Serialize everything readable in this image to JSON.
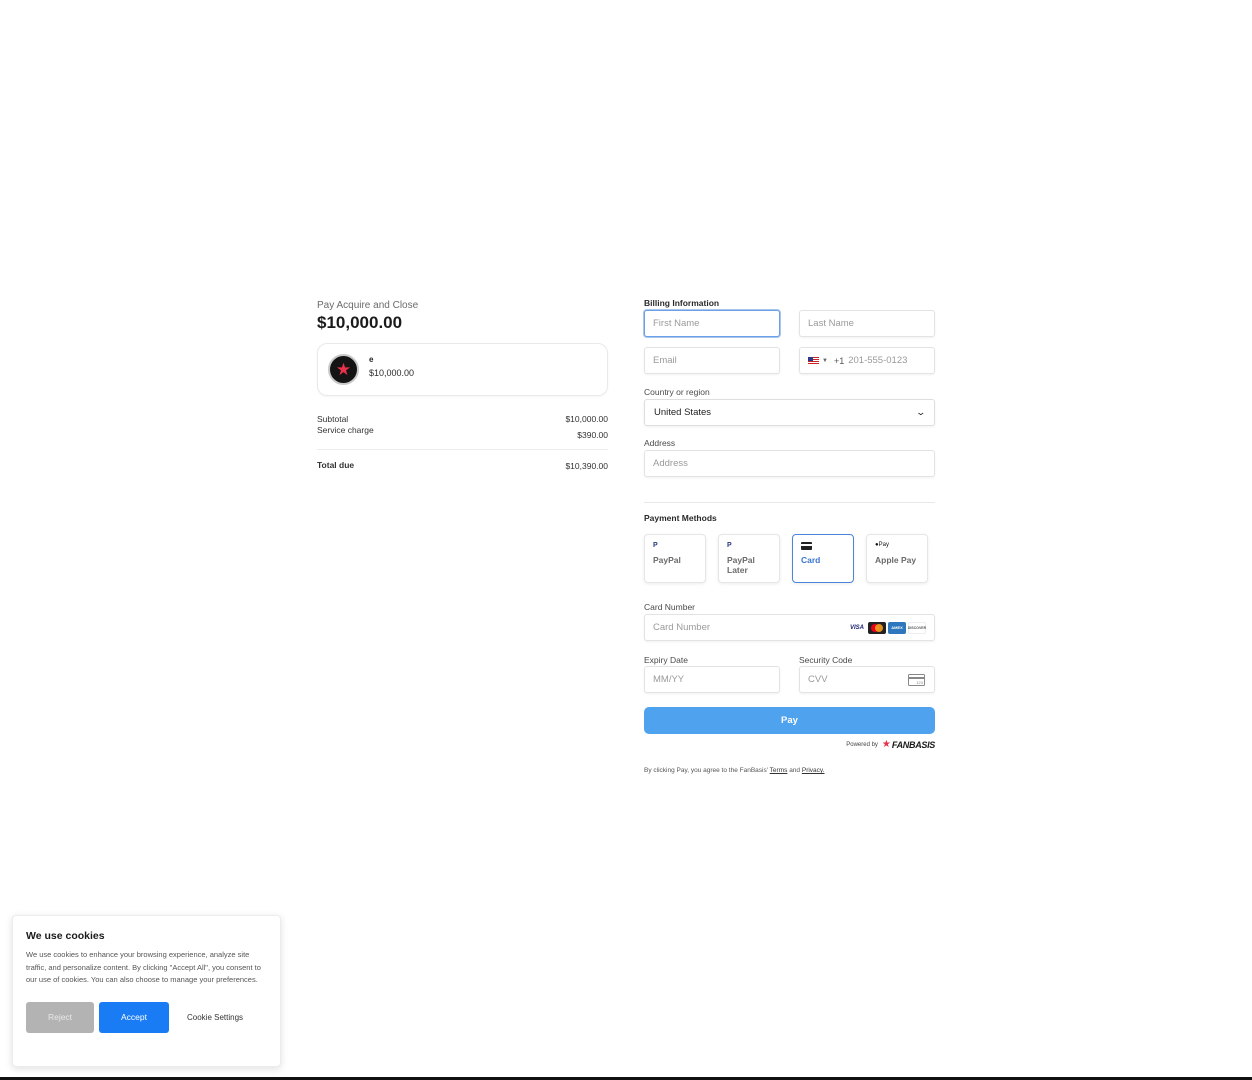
{
  "summary": {
    "label": "Pay Acquire and Close",
    "amount": "$10,000.00",
    "product": {
      "name": "e",
      "price": "$10,000.00",
      "logo_icon": "fanbasis-star-icon"
    },
    "subtotal_label": "Subtotal",
    "subtotal_value": "$10,000.00",
    "service_label": "Service charge",
    "service_value": "$390.00",
    "total_label": "Total due",
    "total_value": "$10,390.00"
  },
  "billing": {
    "title": "Billing Information",
    "first_name_placeholder": "First Name",
    "last_name_placeholder": "Last Name",
    "email_placeholder": "Email",
    "phone_country_code": "+1",
    "phone_placeholder": "201-555-0123",
    "country_label": "Country or region",
    "country_value": "United States",
    "address_label": "Address",
    "address_placeholder": "Address"
  },
  "payment": {
    "title": "Payment Methods",
    "methods": [
      {
        "label": "PayPal",
        "icon": "paypal-icon"
      },
      {
        "label": "PayPal Later",
        "icon": "paypal-icon"
      },
      {
        "label": "Card",
        "icon": "credit-card-icon",
        "selected": true
      },
      {
        "label": "Apple Pay",
        "icon": "apple-pay-icon"
      }
    ],
    "paypal_glyph": "P",
    "applepay_glyph": "●Pay",
    "card_number_label": "Card Number",
    "card_number_placeholder": "Card Number",
    "brands": [
      "VISA",
      "AMEX",
      "DISCOVER"
    ],
    "expiry_label": "Expiry Date",
    "expiry_placeholder": "MM/YY",
    "cvc_label": "Security Code",
    "cvc_placeholder": "CVV",
    "cvv_icon_text": "123",
    "pay_label": "Pay",
    "powered_by": "Powered by",
    "powered_brand": "FANBASIS",
    "terms_prefix": "By clicking Pay, you agree to the FanBasis'",
    "terms_link": "Terms",
    "terms_and": "and",
    "privacy_link": "Privacy."
  },
  "cookie": {
    "title": "We use cookies",
    "body": "We use cookies to enhance your browsing experience, analyze site traffic, and personalize content. By clicking \"Accept All\", you consent to our use of cookies. You can also choose to manage your preferences.",
    "reject_label": "Reject",
    "accept_label": "Accept",
    "settings_label": "Cookie Settings"
  },
  "colors": {
    "pay_button": "#4ea2ee",
    "accept_button": "#1a7cf5",
    "selected_method": "#4a86d8",
    "brand_accent": "#e8314b"
  }
}
